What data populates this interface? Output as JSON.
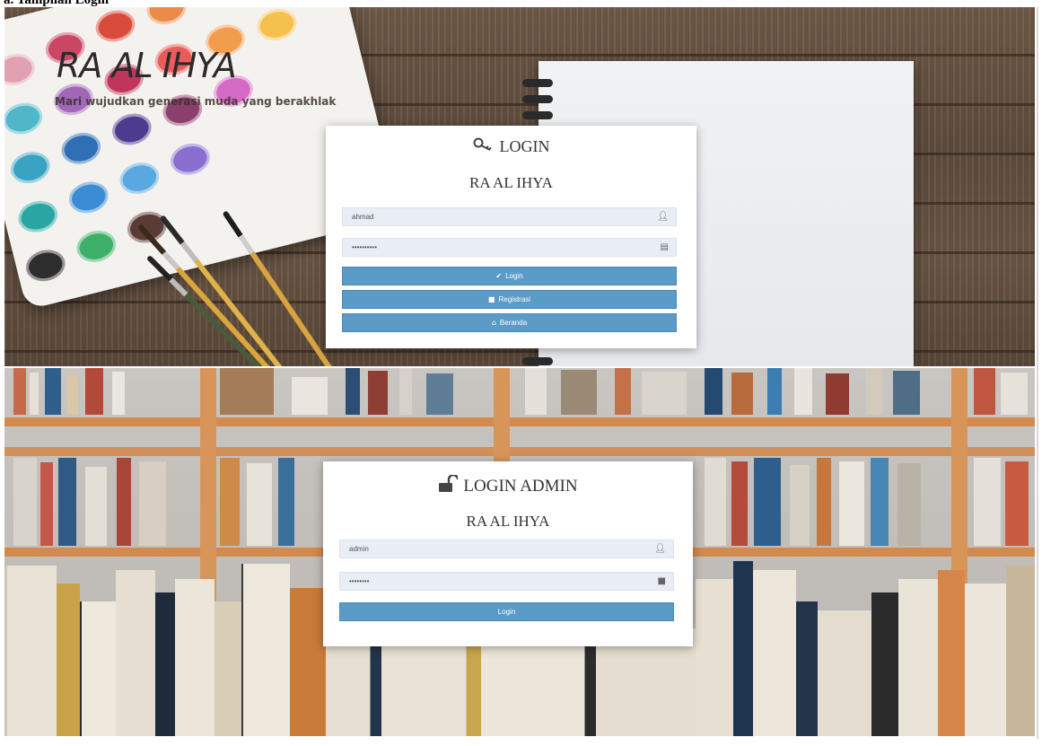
{
  "document": {
    "heading": "a. Tampilan Login"
  },
  "site": {
    "brand": "RA AL IHYA",
    "tagline": "Mari wujudkan generasi muda yang berakhlak"
  },
  "user_login": {
    "title": "LOGIN",
    "title_icon": "key-icon",
    "subtitle": "RA AL IHYA",
    "username_value": "ahmad",
    "password_value": "••••••••••",
    "username_icon": "user-icon",
    "password_icon": "id-card-icon",
    "buttons": [
      {
        "label": "Login",
        "icon": "checkmark-icon"
      },
      {
        "label": "Registrasi",
        "icon": "lock-icon"
      },
      {
        "label": "Beranda",
        "icon": "home-icon"
      }
    ]
  },
  "admin_login": {
    "title": "LOGIN ADMIN",
    "title_icon": "unlock-icon",
    "subtitle": "RA AL IHYA",
    "username_value": "admin",
    "password_value": "••••••••",
    "username_icon": "user-icon",
    "password_icon": "lock-icon",
    "button_label": "Login"
  },
  "colors": {
    "button": "#5b9bc8",
    "field": "#e9edf5",
    "card": "#ffffff"
  }
}
